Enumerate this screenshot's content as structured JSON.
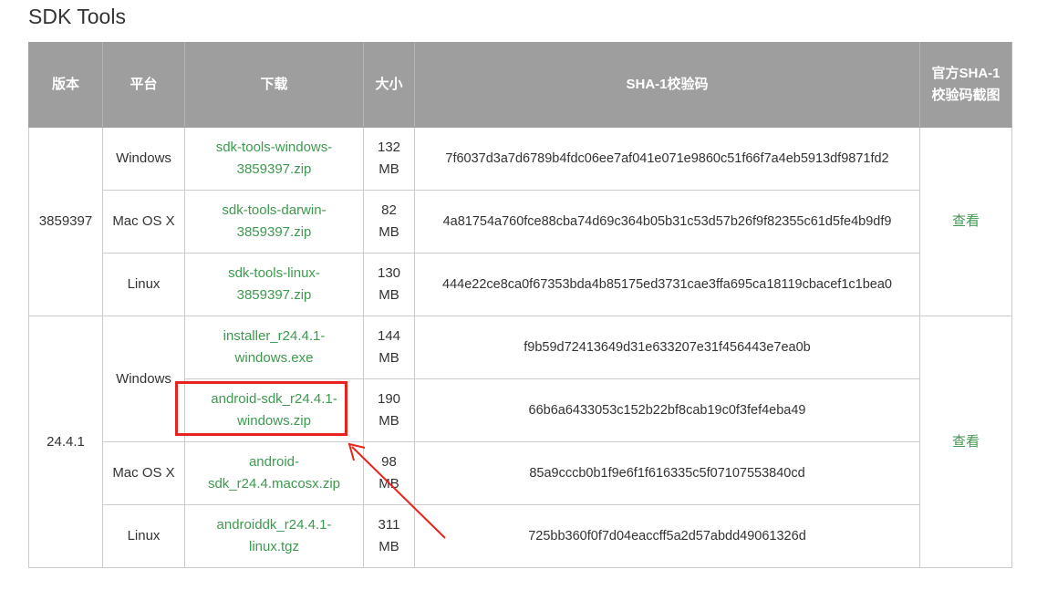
{
  "section": {
    "title": "SDK Tools"
  },
  "table": {
    "headers": {
      "version": "版本",
      "platform": "平台",
      "download": "下载",
      "size": "大小",
      "sha1": "SHA-1校验码",
      "screenshot": "官方SHA-1校验码截图"
    },
    "groups": [
      {
        "version": "3859397",
        "view_label": "查看",
        "rows": [
          {
            "platform": "Windows",
            "file": "sdk-tools-windows-3859397.zip",
            "size": "132 MB",
            "sha1": "7f6037d3a7d6789b4fdc06ee7af041e071e9860c51f66f7a4eb5913df9871fd2"
          },
          {
            "platform": "Mac OS X",
            "file": "sdk-tools-darwin-3859397.zip",
            "size": "82 MB",
            "sha1": "4a81754a760fce88cba74d69c364b05b31c53d57b26f9f82355c61d5fe4b9df9"
          },
          {
            "platform": "Linux",
            "file": "sdk-tools-linux-3859397.zip",
            "size": "130 MB",
            "sha1": "444e22ce8ca0f67353bda4b85175ed3731cae3ffa695ca18119cbacef1c1bea0"
          }
        ]
      },
      {
        "version": "24.4.1",
        "view_label": "查看",
        "platform_windows": "Windows",
        "rows": [
          {
            "file": "installer_r24.4.1-windows.exe",
            "size": "144 MB",
            "sha1": "f9b59d72413649d31e633207e31f456443e7ea0b"
          },
          {
            "file": "android-sdk_r24.4.1-windows.zip",
            "size": "190 MB",
            "sha1": "66b6a6433053c152b22bf8cab19c0f3fef4eba49"
          },
          {
            "platform": "Mac OS X",
            "file": "android-sdk_r24.4.macosx.zip",
            "size": "98 MB",
            "sha1": "85a9cccb0b1f9e6f1f616335c5f07107553840cd"
          },
          {
            "platform": "Linux",
            "file": "androiddk_r24.4.1-linux.tgz",
            "size": "311 MB",
            "sha1": "725bb360f0f7d04eaccff5a2d57abdd49061326d"
          }
        ]
      }
    ]
  },
  "annotation": {
    "highlight_color": "#e8221c",
    "arrow_color": "#e8221c"
  },
  "colors": {
    "header_bg": "#9e9e9e",
    "link": "#3d9a4f",
    "border": "#cccccc"
  }
}
